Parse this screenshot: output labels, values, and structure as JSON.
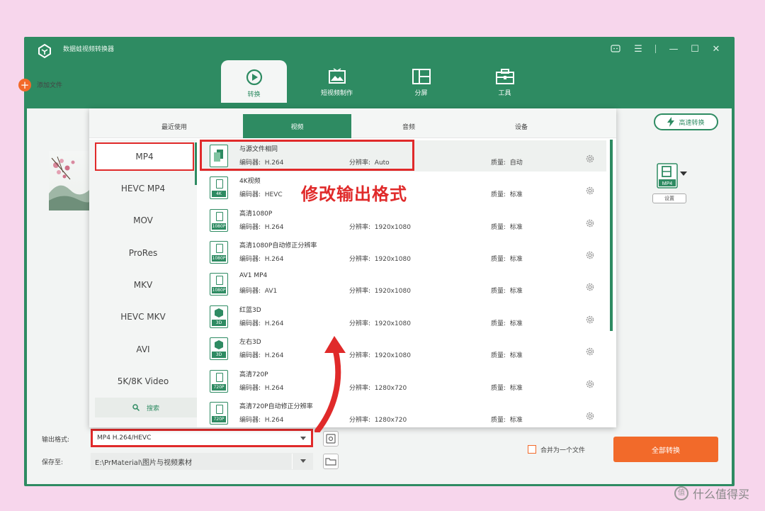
{
  "app": {
    "title": "数据蛙视频转换器"
  },
  "top_tabs": [
    {
      "label": "转换",
      "icon": "convert-icon",
      "active": true
    },
    {
      "label": "短视频制作",
      "icon": "image-icon",
      "active": false
    },
    {
      "label": "分屏",
      "icon": "split-screen-icon",
      "active": false
    },
    {
      "label": "工具",
      "icon": "toolbox-icon",
      "active": false
    }
  ],
  "toolbar": {
    "add_file_label": "添加文件",
    "fast_convert_label": "高速转换"
  },
  "file_item": {
    "format_badge": "MP4",
    "settings_label": "设置"
  },
  "format_panel": {
    "tabs": [
      "最近使用",
      "视频",
      "音频",
      "设备"
    ],
    "active_tab": "视频",
    "formats": [
      "MP4",
      "HEVC MP4",
      "MOV",
      "ProRes",
      "MKV",
      "HEVC MKV",
      "AVI",
      "5K/8K Video"
    ],
    "selected_format": "MP4",
    "search_label": "搜索",
    "presets": [
      {
        "name": "与源文件相同",
        "badge": "",
        "encoder_label": "编码器:",
        "encoder": "H.264",
        "res_label": "分辨率:",
        "resolution": "Auto",
        "quality_label": "质量:",
        "quality": "自动"
      },
      {
        "name": "4K视频",
        "badge": "4K",
        "encoder_label": "编码器:",
        "encoder": "HEVC",
        "res_label": "分辨率:",
        "resolution": "",
        "quality_label": "质量:",
        "quality": "标准"
      },
      {
        "name": "高清1080P",
        "badge": "1080P",
        "encoder_label": "编码器:",
        "encoder": "H.264",
        "res_label": "分辨率:",
        "resolution": "1920x1080",
        "quality_label": "质量:",
        "quality": "标准"
      },
      {
        "name": "高清1080P自动修正分辨率",
        "badge": "1080P",
        "encoder_label": "编码器:",
        "encoder": "H.264",
        "res_label": "分辨率:",
        "resolution": "1920x1080",
        "quality_label": "质量:",
        "quality": "标准"
      },
      {
        "name": "AV1 MP4",
        "badge": "1080P",
        "encoder_label": "编码器:",
        "encoder": "AV1",
        "res_label": "分辨率:",
        "resolution": "1920x1080",
        "quality_label": "质量:",
        "quality": "标准"
      },
      {
        "name": "红蓝3D",
        "badge": "3D",
        "encoder_label": "编码器:",
        "encoder": "H.264",
        "res_label": "分辨率:",
        "resolution": "1920x1080",
        "quality_label": "质量:",
        "quality": "标准"
      },
      {
        "name": "左右3D",
        "badge": "3D",
        "encoder_label": "编码器:",
        "encoder": "H.264",
        "res_label": "分辨率:",
        "resolution": "1920x1080",
        "quality_label": "质量:",
        "quality": "标准"
      },
      {
        "name": "高清720P",
        "badge": "720P",
        "encoder_label": "编码器:",
        "encoder": "H.264",
        "res_label": "分辨率:",
        "resolution": "1280x720",
        "quality_label": "质量:",
        "quality": "标准"
      },
      {
        "name": "高清720P自动修正分辨率",
        "badge": "720P",
        "encoder_label": "编码器:",
        "encoder": "H.264",
        "res_label": "分辨率:",
        "resolution": "1280x720",
        "quality_label": "质量:",
        "quality": "标准"
      }
    ]
  },
  "annotation": {
    "text": "修改输出格式"
  },
  "bottom": {
    "output_format_label": "输出格式:",
    "output_format_value": "MP4 H.264/HEVC",
    "save_to_label": "保存至:",
    "save_path": "E:\\PrMaterial\\图片与视频素材",
    "merge_label": "合并为一个文件",
    "convert_all_label": "全部转换"
  },
  "watermark": {
    "symbol": "值",
    "text": "什么值得买"
  },
  "colors": {
    "primary": "#2e8b62",
    "accent": "#f26a2a",
    "highlight": "#e02a2a"
  }
}
